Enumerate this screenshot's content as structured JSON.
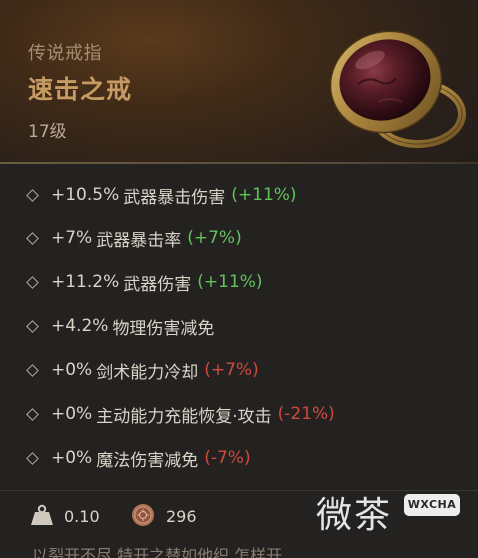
{
  "item": {
    "rarity": "传说戒指",
    "name": "速击之戒",
    "level": "17级"
  },
  "stats": [
    {
      "value": "+10.5%",
      "name": "武器暴击伤害",
      "compare": "(+11%)",
      "trend": "up"
    },
    {
      "value": "+7%",
      "name": "武器暴击率",
      "compare": "(+7%)",
      "trend": "up"
    },
    {
      "value": "+11.2%",
      "name": "武器伤害",
      "compare": "(+11%)",
      "trend": "up"
    },
    {
      "value": "+4.2%",
      "name": "物理伤害减免",
      "compare": "",
      "trend": ""
    },
    {
      "value": "+0%",
      "name": "剑术能力冷却",
      "compare": "(+7%)",
      "trend": "down"
    },
    {
      "value": "+0%",
      "name": "主动能力充能恢复·攻击",
      "compare": "(-21%)",
      "trend": "down"
    },
    {
      "value": "+0%",
      "name": "魔法伤害减免",
      "compare": "(-7%)",
      "trend": "down"
    }
  ],
  "footer": {
    "weight": "0.10",
    "weight_icon": "weight-icon",
    "price": "296",
    "coin_icon": "coin-icon",
    "cut_off_text": "以裂开不尽 特开之替如他织 怎样开"
  },
  "watermark": {
    "text": "微茶",
    "badge": "WXCHA"
  },
  "colors": {
    "title_gold": "#c79a63",
    "increase_green": "#62c25a",
    "decrease_red": "#cf4a3c"
  }
}
